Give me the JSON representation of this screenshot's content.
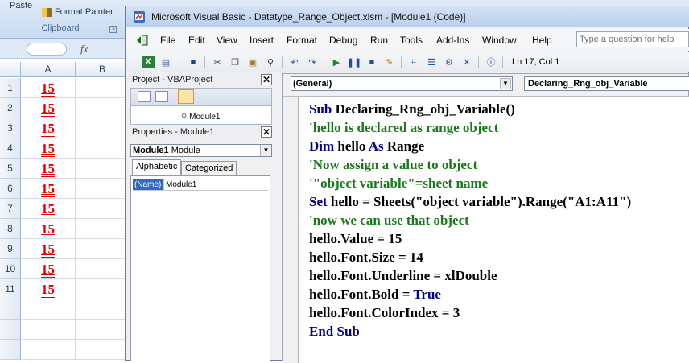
{
  "excel": {
    "paste_label": "Paste",
    "format_painter_label": "Format Painter",
    "clipboard_group_label": "Clipboard",
    "fx_label": "fx",
    "columns": [
      "A",
      "B"
    ],
    "rows": [
      {
        "num": "1",
        "a": "15"
      },
      {
        "num": "2",
        "a": "15"
      },
      {
        "num": "3",
        "a": "15"
      },
      {
        "num": "4",
        "a": "15"
      },
      {
        "num": "5",
        "a": "15"
      },
      {
        "num": "6",
        "a": "15"
      },
      {
        "num": "7",
        "a": "15"
      },
      {
        "num": "8",
        "a": "15"
      },
      {
        "num": "9",
        "a": "15"
      },
      {
        "num": "10",
        "a": "15"
      },
      {
        "num": "11",
        "a": "15"
      }
    ],
    "cell_color": "#e60000"
  },
  "vba": {
    "title": "Microsoft Visual Basic - Datatype_Range_Object.xlsm - [Module1 (Code)]",
    "menu": [
      "File",
      "Edit",
      "View",
      "Insert",
      "Format",
      "Debug",
      "Run",
      "Tools",
      "Add-Ins",
      "Window",
      "Help"
    ],
    "help_placeholder": "Type a question for help",
    "cursor_position": "Ln 17, Col 1",
    "project_title": "Project - VBAProject",
    "tree_module": "Module1",
    "properties_title": "Properties - Module1",
    "properties_object": "Module1",
    "properties_object_type": "Module",
    "tabs": [
      "Alphabetic",
      "Categorized"
    ],
    "prop_name": "(Name)",
    "prop_value": "Module1",
    "general_combo": "(General)",
    "procedure_combo": "Declaring_Rng_obj_Variable",
    "keyword_color": "#00007f",
    "comment_color": "#1a7a1a"
  },
  "code": {
    "line1_kw": "Sub",
    "line1_rest": " Declaring_Rng_obj_Variable()",
    "line2": "'hello is declared as range object",
    "line3_kw1": "Dim",
    "line3_mid": " hello ",
    "line3_kw2": "As",
    "line3_rest": " Range",
    "line4": "'Now assign a value to object",
    "line5": "'\"object variable\"=sheet name",
    "line6_kw": "Set",
    "line6_rest": " hello = Sheets(\"object variable\").Range(\"A1:A11\")",
    "line7": "'now we can use that object",
    "line8": "hello.Value = 15",
    "line9": "hello.Font.Size = 14",
    "line10": "hello.Font.Underline = xlDouble",
    "line11_pre": "hello.Font.Bold = ",
    "line11_kw": "True",
    "line12": "hello.Font.ColorIndex = 3",
    "line13": "End Sub"
  }
}
